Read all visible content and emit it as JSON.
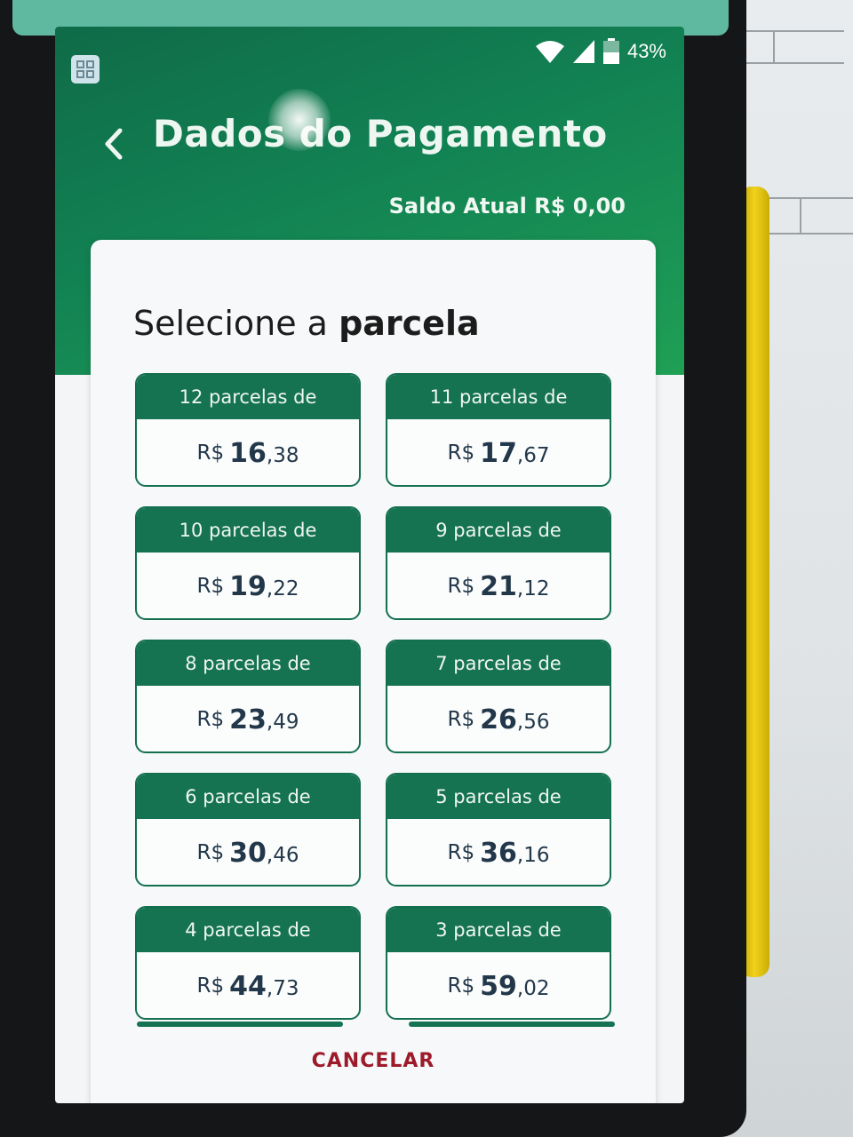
{
  "status_bar": {
    "battery_percent": "43%",
    "icons": [
      "wifi-icon",
      "signal-icon",
      "battery-icon"
    ]
  },
  "header": {
    "title": "Dados do Pagamento",
    "balance": "Saldo Atual R$ 0,00"
  },
  "card": {
    "title_prefix": "Selecione a",
    "title_emphasis": "parcela",
    "options": [
      {
        "label": "12 parcelas de",
        "currency": "R$",
        "integer": "16",
        "cents": ",38"
      },
      {
        "label": "11 parcelas de",
        "currency": "R$",
        "integer": "17",
        "cents": ",67"
      },
      {
        "label": "10 parcelas de",
        "currency": "R$",
        "integer": "19",
        "cents": ",22"
      },
      {
        "label": "9 parcelas de",
        "currency": "R$",
        "integer": "21",
        "cents": ",12"
      },
      {
        "label": "8 parcelas de",
        "currency": "R$",
        "integer": "23",
        "cents": ",49"
      },
      {
        "label": "7 parcelas de",
        "currency": "R$",
        "integer": "26",
        "cents": ",56"
      },
      {
        "label": "6 parcelas de",
        "currency": "R$",
        "integer": "30",
        "cents": ",46"
      },
      {
        "label": "5 parcelas de",
        "currency": "R$",
        "integer": "36",
        "cents": ",16"
      },
      {
        "label": "4 parcelas de",
        "currency": "R$",
        "integer": "44",
        "cents": ",73"
      },
      {
        "label": "3 parcelas de",
        "currency": "R$",
        "integer": "59",
        "cents": ",02"
      }
    ],
    "cancel_label": "CANCELAR"
  },
  "colors": {
    "header_green": "#128253",
    "option_green": "#157352",
    "cancel_red": "#9c1a2a"
  }
}
